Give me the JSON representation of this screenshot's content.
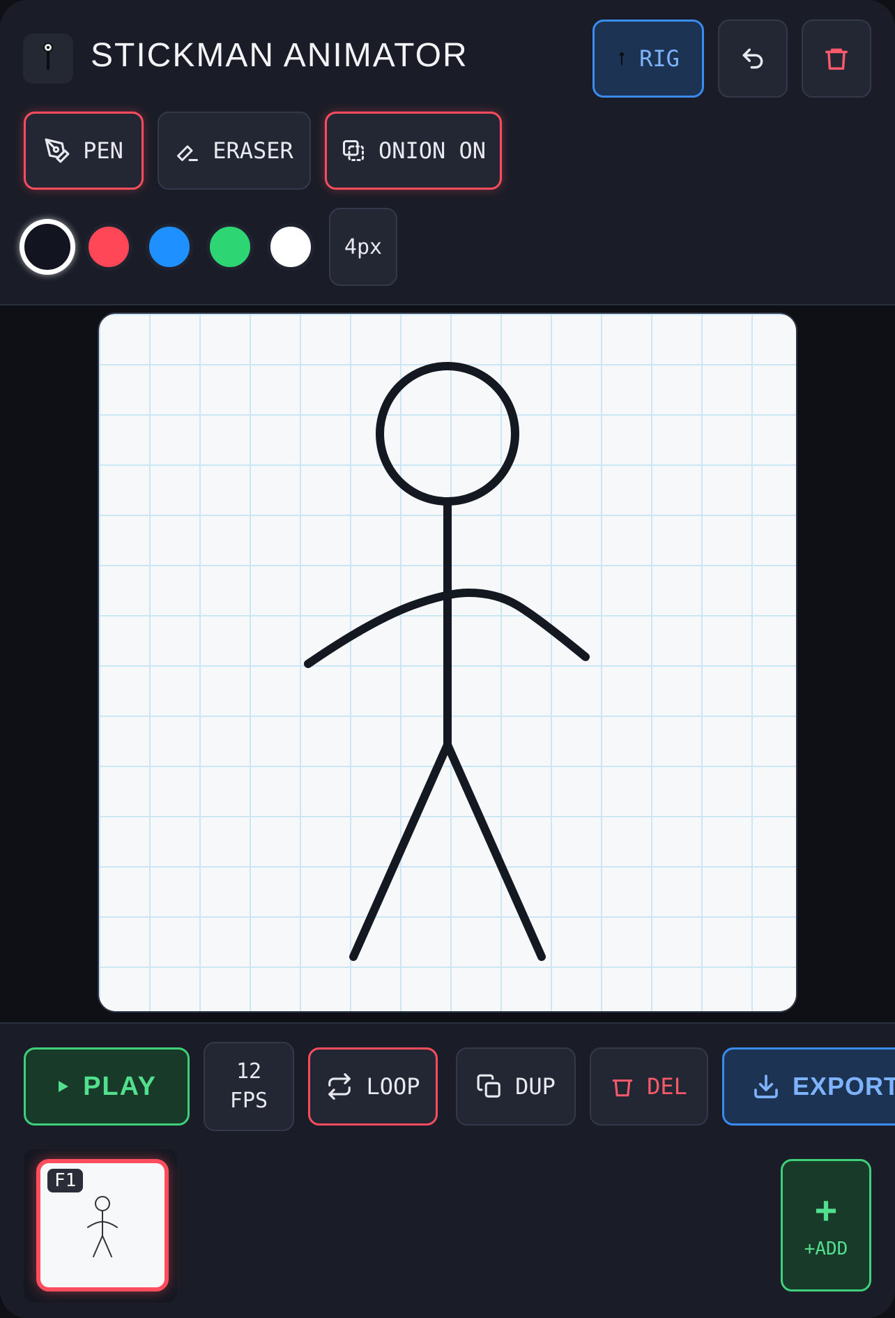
{
  "header": {
    "title": "STICKMAN ANIMATOR",
    "rig_label": "RIG"
  },
  "tools": {
    "pen_label": "PEN",
    "eraser_label": "ERASER",
    "onion_label": "ONION ON"
  },
  "colors": {
    "accent_red": "#ff4d5e",
    "accent_blue": "#3b8cf0",
    "accent_green": "#3fd07c",
    "palette": [
      "#12151f",
      "#ff4757",
      "#1e90ff",
      "#2ed573",
      "#ffffff"
    ],
    "selected_index": 0
  },
  "brush": {
    "size_label": "4px"
  },
  "playback": {
    "play_label": "PLAY",
    "fps_value": "12",
    "fps_unit": "FPS",
    "loop_label": "LOOP",
    "dup_label": "DUP",
    "del_label": "DEL",
    "export_label": "EXPORT"
  },
  "timeline": {
    "frames": [
      {
        "label": "F1",
        "selected": true
      }
    ],
    "add_label": "+ADD"
  },
  "icons": {
    "undo": "undo-icon",
    "trash": "trash-icon",
    "pen": "pen-icon",
    "eraser": "eraser-icon",
    "onion": "onion-skin-icon",
    "play": "play-icon",
    "loop": "loop-icon",
    "dup": "duplicate-icon",
    "del": "delete-icon",
    "export": "download-icon"
  }
}
